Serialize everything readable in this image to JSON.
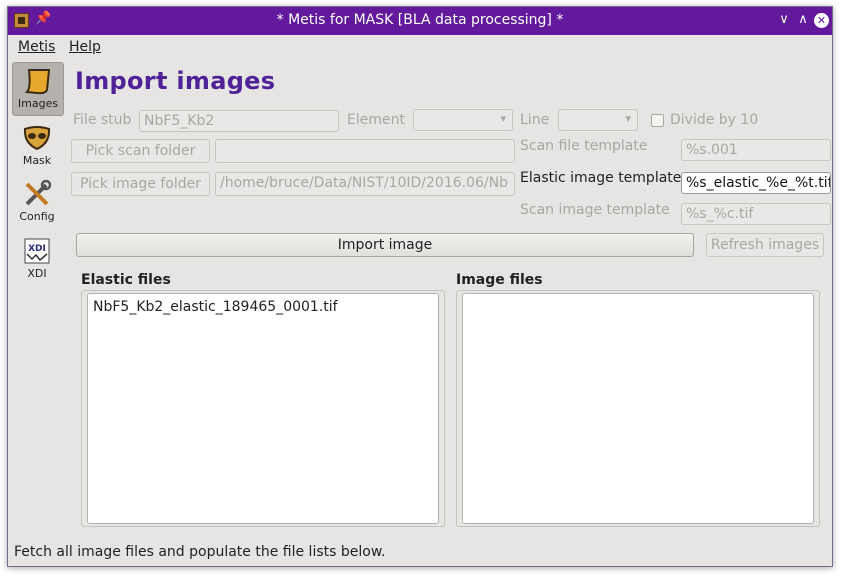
{
  "window": {
    "title": "* Metis for MASK [BLA data processing] *",
    "accent_color": "#63199c"
  },
  "titlebar": {
    "app_icon": "metis-app-icon",
    "pin_icon": "pin-icon",
    "minimize_icon": "chevron-down-icon",
    "maximize_icon": "chevron-up-icon",
    "close_icon": "close-icon"
  },
  "menu": {
    "metis": "Metis",
    "help": "Help"
  },
  "sidebar": {
    "items": [
      {
        "label": "Images",
        "icon": "images-icon",
        "active": true
      },
      {
        "label": "Mask",
        "icon": "mask-icon",
        "active": false
      },
      {
        "label": "Config",
        "icon": "config-icon",
        "active": false
      },
      {
        "label": "XDI",
        "icon": "xdi-icon",
        "active": false
      }
    ]
  },
  "main": {
    "title": "Import images",
    "title_color": "#4f2297",
    "file_stub": {
      "label": "File stub",
      "value": "NbF5_Kb2"
    },
    "element": {
      "label": "Element",
      "value": ""
    },
    "line": {
      "label": "Line",
      "value": ""
    },
    "divide_by_10": {
      "label": "Divide by 10",
      "checked": false
    },
    "pick_scan_folder": {
      "label": "Pick scan folder",
      "value": ""
    },
    "pick_image_folder": {
      "label": "Pick image folder",
      "value": "/home/bruce/Data/NIST/10ID/2016.06/Nb"
    },
    "scan_file_template": {
      "label": "Scan file template",
      "value": "%s.001"
    },
    "elastic_image_template": {
      "label": "Elastic image template",
      "value": "%s_elastic_%e_%t.tif"
    },
    "scan_image_template": {
      "label": "Scan image template",
      "value": "%s_%c.tif"
    },
    "import_image_button": "Import image",
    "refresh_images_button": "Refresh images",
    "elastic_files": {
      "title": "Elastic files",
      "items": [
        "NbF5_Kb2_elastic_189465_0001.tif"
      ]
    },
    "image_files": {
      "title": "Image files",
      "items": []
    }
  },
  "status": {
    "text": "Fetch all image files and populate the file lists below."
  }
}
